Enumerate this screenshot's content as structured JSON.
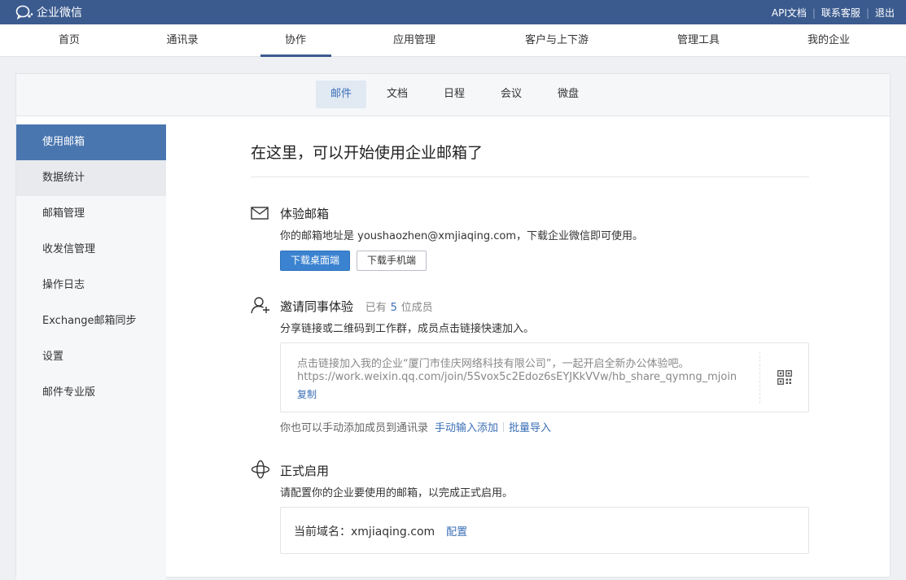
{
  "app": {
    "title": "企业微信"
  },
  "toplinks": [
    "API文档",
    "联系客服",
    "退出"
  ],
  "mainnav": [
    "首页",
    "通讯录",
    "协作",
    "应用管理",
    "客户与上下游",
    "管理工具",
    "我的企业"
  ],
  "subtabs": [
    "邮件",
    "文档",
    "日程",
    "会议",
    "微盘"
  ],
  "sidebar": [
    {
      "label": "使用邮箱"
    },
    {
      "label": "数据统计"
    },
    {
      "label": "邮箱管理"
    },
    {
      "label": "收发信管理"
    },
    {
      "label": "操作日志"
    },
    {
      "label": "Exchange邮箱同步"
    },
    {
      "label": "设置"
    },
    {
      "label": "邮件专业版"
    }
  ],
  "content": {
    "title": "在这里，可以开始使用企业邮箱了",
    "trial": {
      "title": "体验邮箱",
      "desc": "你的邮箱地址是 youshaozhen@xmjiaqing.com，下载企业微信即可使用。",
      "btn_desktop": "下载桌面端",
      "btn_mobile": "下载手机端"
    },
    "invite": {
      "title": "邀请同事体验",
      "members_prefix": "已有",
      "members_count": "5",
      "members_suffix": "位成员",
      "desc": "分享链接或二维码到工作群，成员点击链接快速加入。",
      "link_line1": "点击链接加入我的企业“厦门市佳庆网络科技有限公司”，一起开启全新办公体验吧。",
      "link_line2": "https://work.weixin.qq.com/join/5Svox5c2Edoz6sEYJKkVVw/hb_share_qymng_mjoin",
      "copy": "复制",
      "add_prefix": "你也可以手动添加成员到通讯录",
      "add_manual": "手动输入添加",
      "add_batch": "批量导入"
    },
    "formal": {
      "title": "正式启用",
      "desc": "请配置你的企业要使用的邮箱，以完成正式启用。",
      "domain_label": "当前域名：",
      "domain_value": "xmjiaqing.com",
      "configure": "配置"
    }
  }
}
